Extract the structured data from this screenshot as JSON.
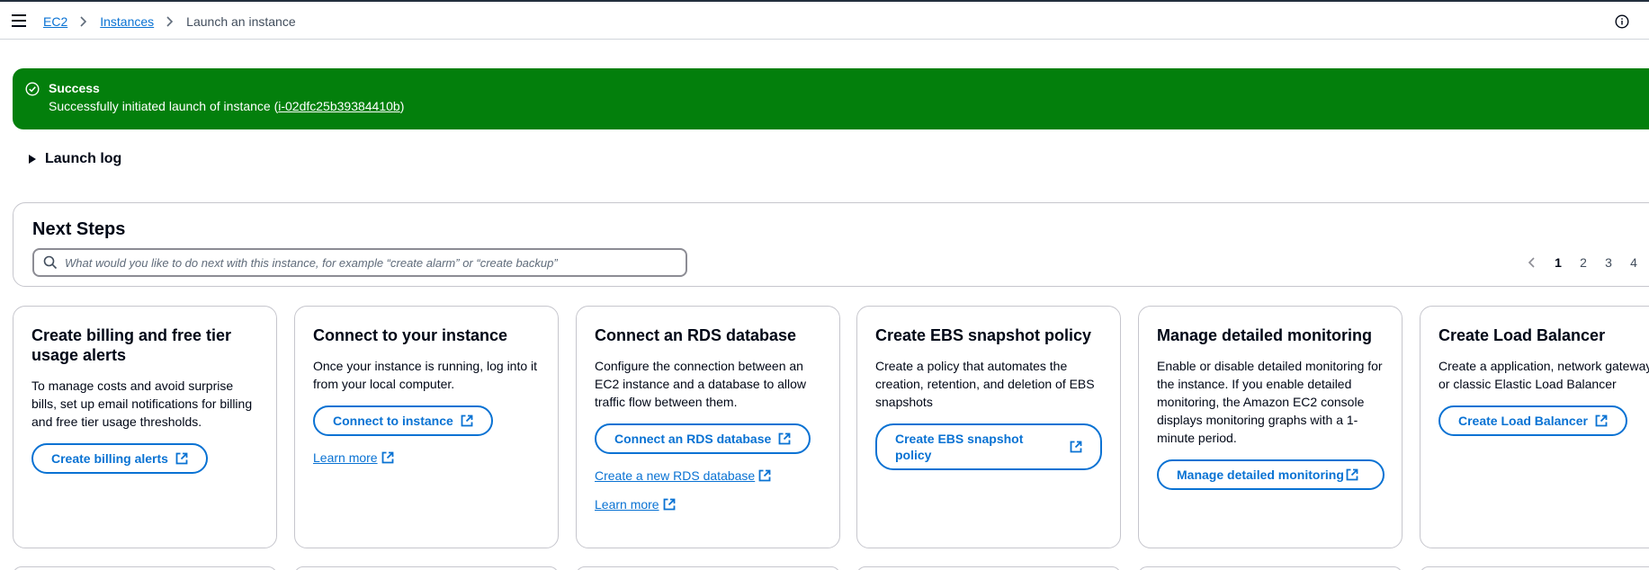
{
  "breadcrumb": {
    "items": [
      "EC2",
      "Instances"
    ],
    "current": "Launch an instance"
  },
  "banner": {
    "title": "Success",
    "message_prefix": "Successfully initiated launch of instance (",
    "instance_id": "i-02dfc25b39384410b",
    "message_suffix": ")",
    "color": "#037f0c"
  },
  "launch_log": {
    "label": "Launch log"
  },
  "next_steps": {
    "title": "Next Steps",
    "search_placeholder": "What would you like to do next with this instance, for example “create alarm” or “create backup”",
    "pages": [
      "1",
      "2",
      "3",
      "4"
    ],
    "active_page": "1"
  },
  "cards": [
    {
      "title": "Create billing and free tier usage alerts",
      "desc": "To manage costs and avoid surprise bills, set up email notifications for billing and free tier usage thresholds.",
      "button": "Create billing alerts"
    },
    {
      "title": "Connect to your instance",
      "desc": "Once your instance is running, log into it from your local computer.",
      "button": "Connect to instance",
      "link1": "Learn more"
    },
    {
      "title": "Connect an RDS database",
      "desc": "Configure the connection between an EC2 instance and a database to allow traffic flow between them.",
      "button": "Connect an RDS database",
      "link1": "Create a new RDS database",
      "link2": "Learn more"
    },
    {
      "title": "Create EBS snapshot policy",
      "desc": "Create a policy that automates the creation, retention, and deletion of EBS snapshots",
      "button": "Create EBS snapshot policy"
    },
    {
      "title": "Manage detailed monitoring",
      "desc": "Enable or disable detailed monitoring for the instance. If you enable detailed monitoring, the Amazon EC2 console displays monitoring graphs with a 1-minute period.",
      "button": "Manage detailed monitoring"
    },
    {
      "title": "Create Load Balancer",
      "desc": "Create a application, network gateway or classic Elastic Load Balancer",
      "button": "Create Load Balancer"
    }
  ],
  "colors": {
    "link": "#0972d3",
    "text": "#000716",
    "border": "#c6c6cd"
  }
}
